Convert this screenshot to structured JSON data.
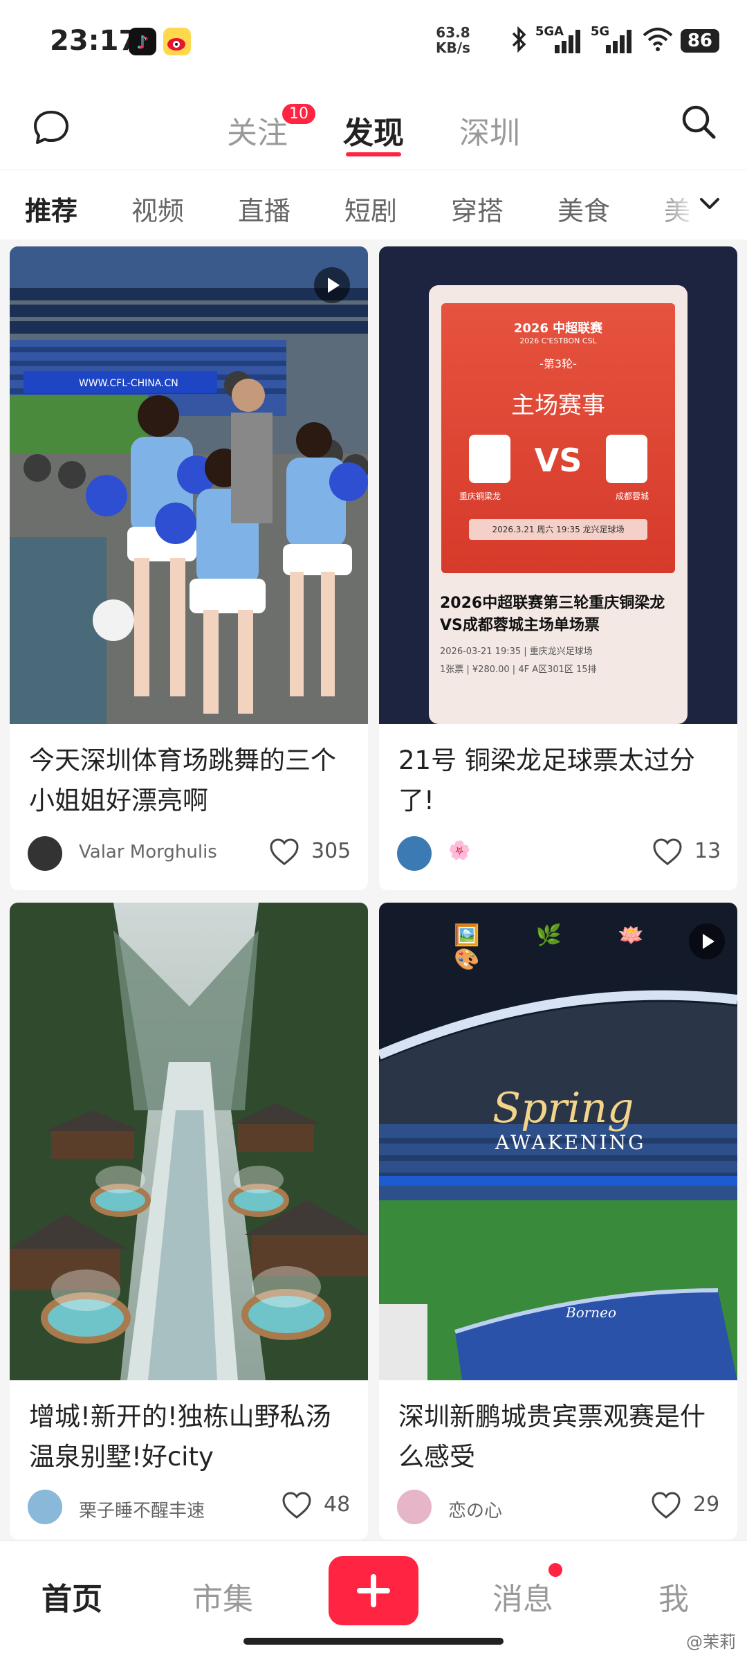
{
  "status_bar": {
    "time": "23:17",
    "net_speed_value": "63.8",
    "net_speed_unit": "KB/s",
    "signal1_label": "5GA",
    "signal2_label": "5G",
    "battery": "86"
  },
  "top_nav": {
    "tabs": [
      {
        "label": "关注",
        "badge": "10"
      },
      {
        "label": "发现"
      },
      {
        "label": "深圳"
      }
    ]
  },
  "categories": [
    "推荐",
    "视频",
    "直播",
    "短剧",
    "穿搭",
    "美食",
    "美"
  ],
  "cards": [
    {
      "title": "今天深圳体育场跳舞的三个小姐姐好漂亮啊",
      "author": "Valar Morghulis",
      "likes": "305",
      "image_text": "WWW.CFL-CHINA.CN"
    },
    {
      "title": "21号 铜梁龙足球票太过分了!",
      "author": "🌸",
      "likes": "13",
      "ticket": {
        "league": "2026 中超联赛",
        "league_en": "2026 C'ESTBON CSL",
        "round": "-第3轮-",
        "event": "主场赛事",
        "vs": "VS",
        "home": "重庆铜梁龙",
        "away": "成都蓉城",
        "datetime": "2026.3.21 周六 19:35 龙兴足球场",
        "caption": "2026中超联赛第三轮重庆铜梁龙VS成都蓉城主场单场票",
        "detail1": "2026-03-21 19:35 | 重庆龙兴足球场",
        "detail2": "1张票 | ¥280.00 | 4F A区301区 15排"
      }
    },
    {
      "title": "增城!新开的!独栋山野私汤温泉别墅!好city",
      "author": "栗子睡不醒丰速",
      "likes": "48"
    },
    {
      "title": "深圳新鹏城贵宾票观赛是什么感受",
      "author": "恋の心",
      "likes": "29",
      "overlay1": "Spring",
      "overlay2": "AWAKENING",
      "sticker_icons": "🖼️ 🌿 🪷 🎨",
      "banner_text": "Borneo"
    }
  ],
  "bottom_nav": {
    "items": [
      "首页",
      "市集",
      "+",
      "消息",
      "我"
    ]
  },
  "watermark": "@茉莉",
  "colors": {
    "accent": "#ff2442"
  }
}
